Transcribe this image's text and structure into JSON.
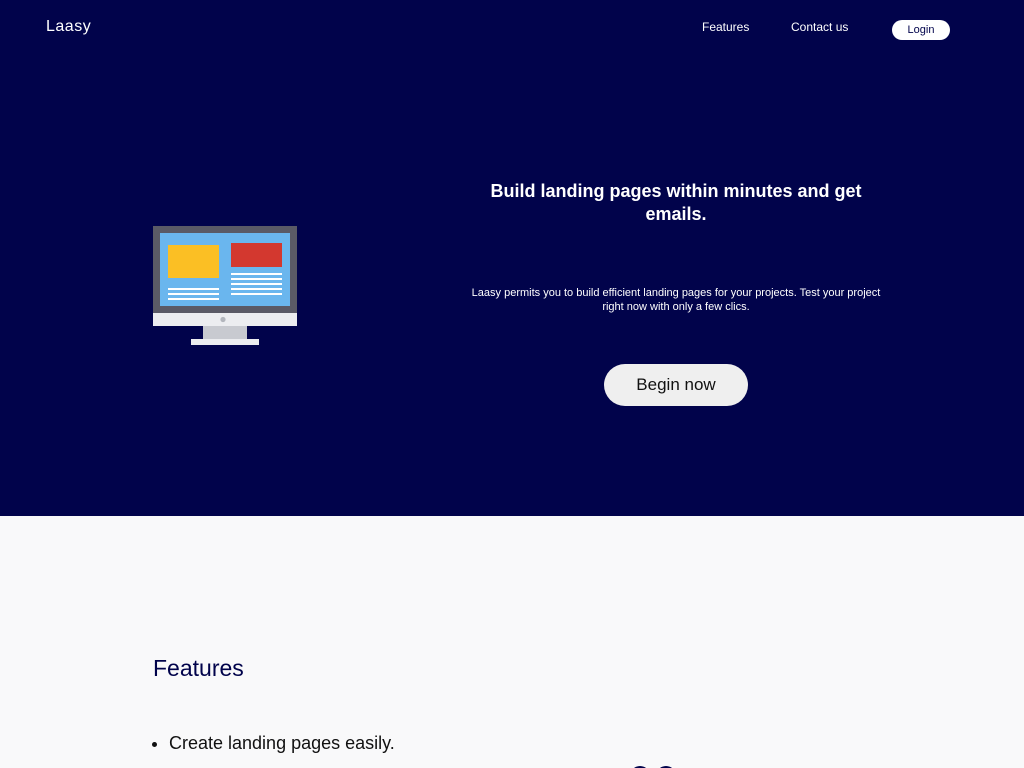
{
  "nav": {
    "logo": "Laasy",
    "features": "Features",
    "contact": "Contact us",
    "login": "Login"
  },
  "hero": {
    "headline": "Build landing pages within minutes and get emails.",
    "subtext": "Laasy permits you to build efficient landing pages for your projects. Test your project right now with only a few clics.",
    "cta": "Begin now",
    "illustration": "monitor-icon"
  },
  "features": {
    "title": "Features",
    "items": [
      "Create landing pages easily."
    ]
  },
  "colors": {
    "hero_bg": "#01034b",
    "page_bg": "#f9f9fa",
    "button_bg": "#efefef",
    "accent_yellow": "#fbbf24",
    "accent_red": "#d3382f",
    "screen_blue": "#6ab6ee"
  }
}
